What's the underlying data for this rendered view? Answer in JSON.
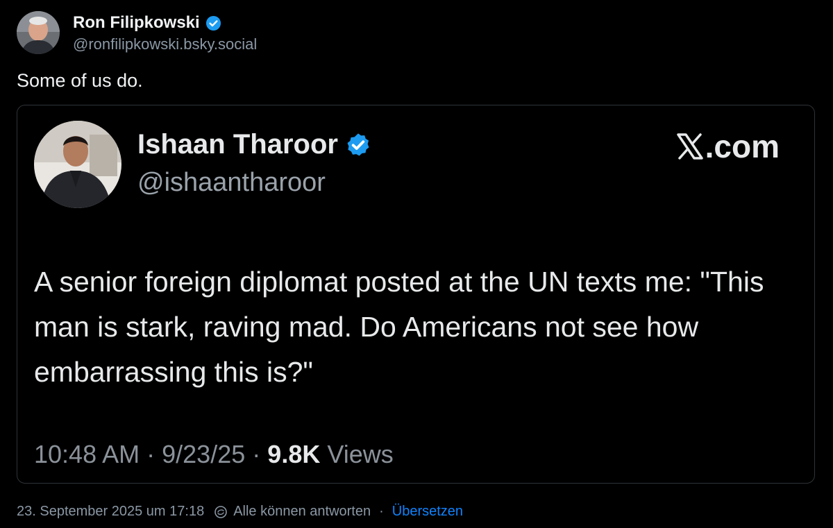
{
  "post": {
    "author": {
      "name": "Ron Filipkowski",
      "handle": "@ronfilipkowski.bsky.social",
      "verified": true,
      "avatar": "avatar-photo"
    },
    "text": "Some of us do.",
    "embed": {
      "author": {
        "name": "Ishaan Tharoor",
        "handle": "@ishaantharoor",
        "verified": true,
        "avatar": "avatar-photo"
      },
      "brand": ".com",
      "brand_icon": "x-logo-icon",
      "text": "A senior foreign diplomat posted at the UN texts me: \"This man is stark, raving mad. Do Americans not see how embarrassing this is?\"",
      "time": "10:48 AM",
      "date": "9/23/25",
      "views_count": "9.8K",
      "views_label": "Views",
      "separator": "·"
    },
    "footer": {
      "timestamp": "23. September 2025 um 17:18",
      "reply_setting": "Alle können antworten",
      "separator": "·",
      "translate_label": "Übersetzen"
    }
  },
  "colors": {
    "background": "#000000",
    "text": "#f1f3f5",
    "muted": "#8b98a5",
    "verified": "#1d9bf0",
    "link": "#1083fe",
    "border": "#2e3438"
  }
}
